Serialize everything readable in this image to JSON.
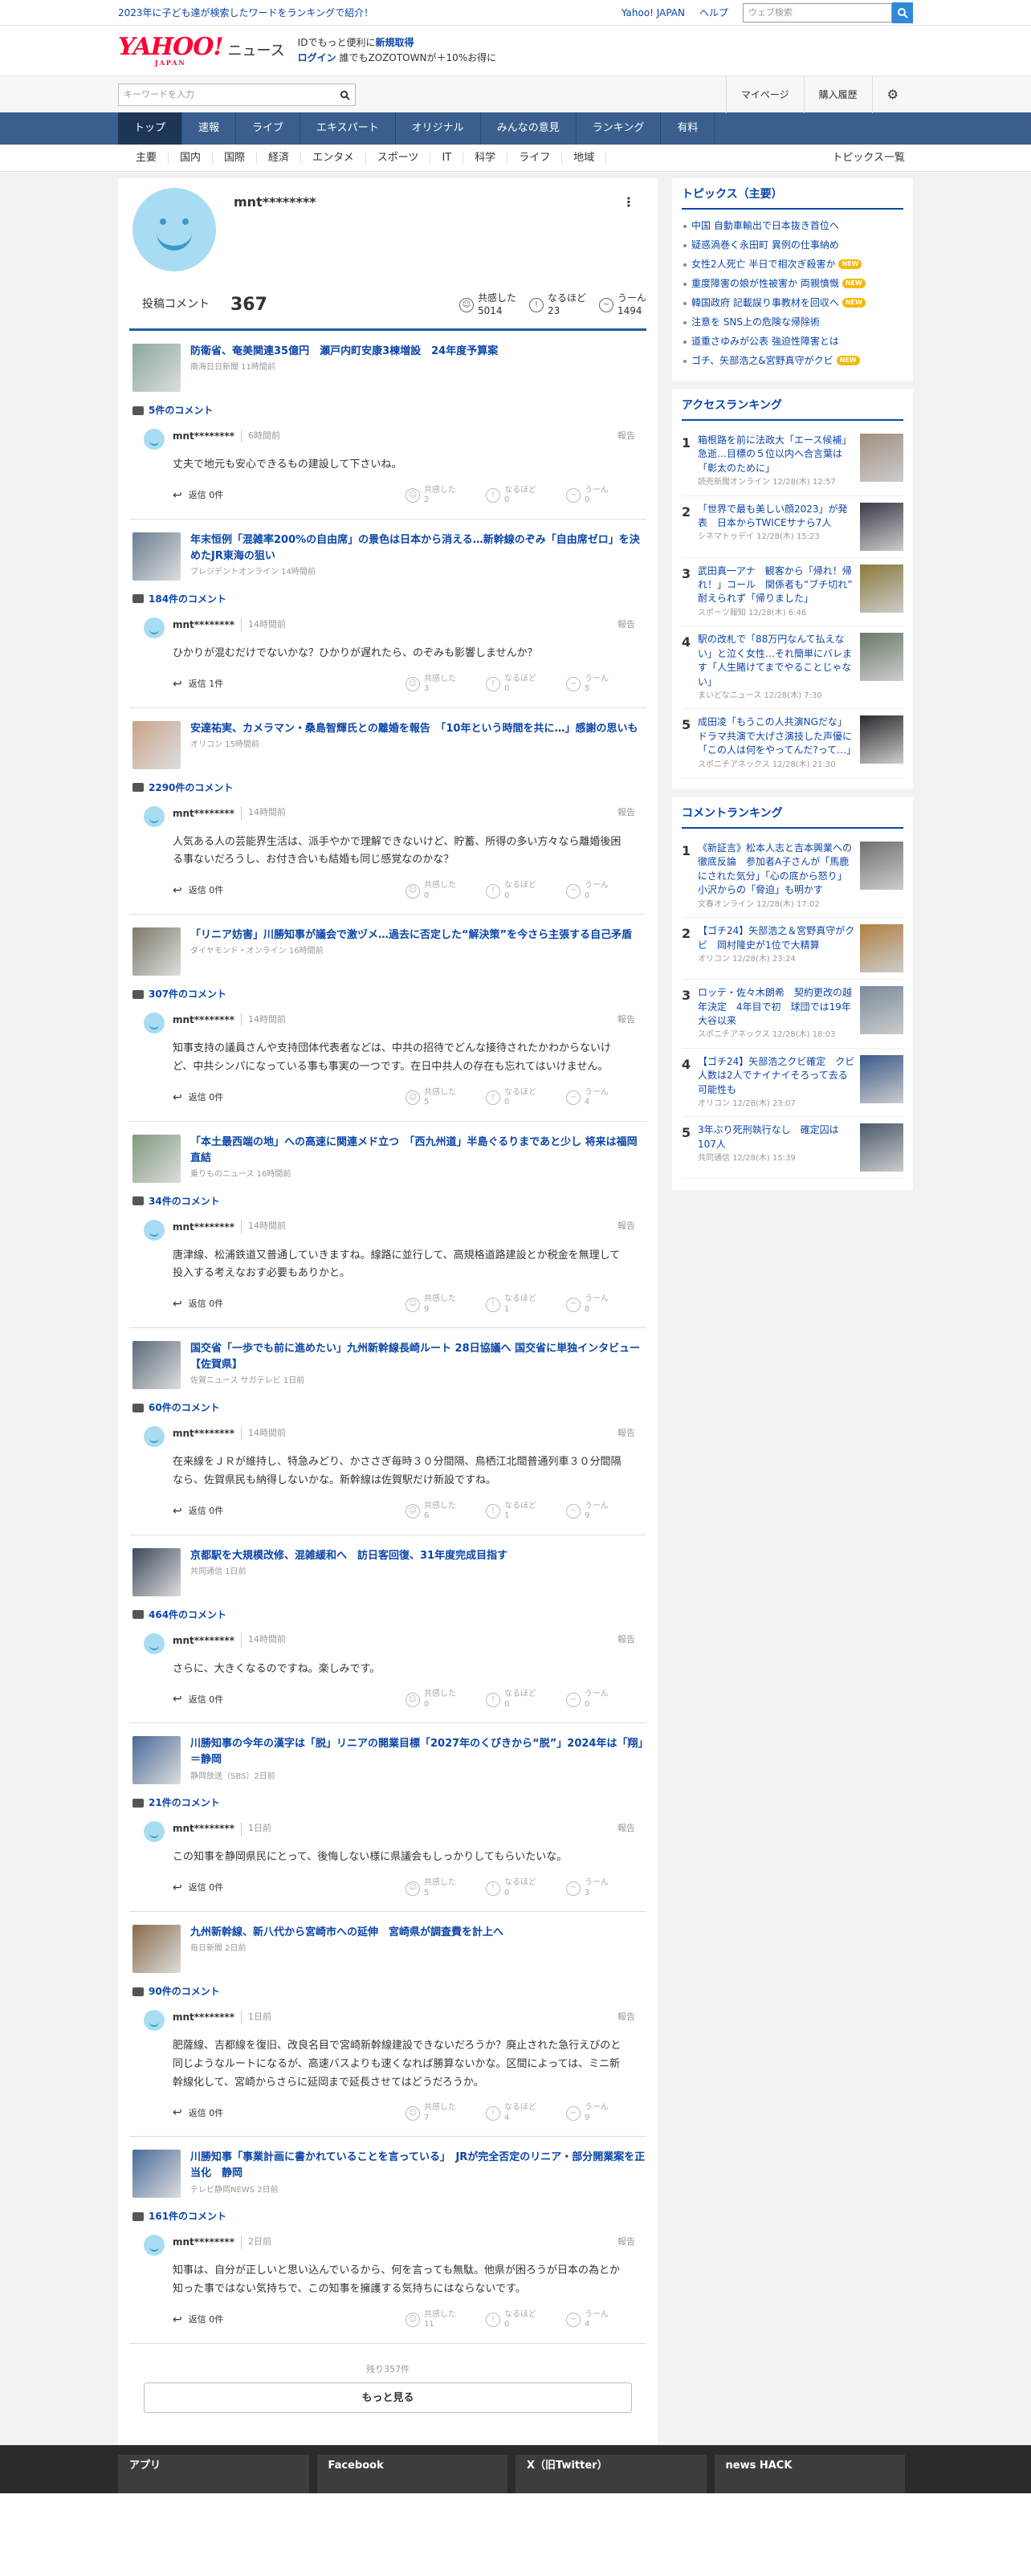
{
  "header": {
    "promo": "2023年に子ども達が検索したワードをランキングで紹介！",
    "yahoo_japan": "Yahoo! JAPAN",
    "help": "ヘルプ",
    "web_search_placeholder": "ウェブ検索",
    "logo_main": "YAHOO!",
    "logo_sub": "JAPAN",
    "news_word": "ニュース",
    "id_line_prefix": "IDでもっと便利に",
    "id_line_link": "新規取得",
    "login": "ログイン",
    "zozo": "誰でもZOZOTOWNが＋10%お得に",
    "keyword_placeholder": "キーワードを入力",
    "mypage": "マイページ",
    "purchase_history": "購入履歴"
  },
  "nav": [
    "トップ",
    "速報",
    "ライブ",
    "エキスパート",
    "オリジナル",
    "みんなの意見",
    "ランキング",
    "有料"
  ],
  "subnav": [
    "主要",
    "国内",
    "国際",
    "経済",
    "エンタメ",
    "スポーツ",
    "IT",
    "科学",
    "ライフ",
    "地域"
  ],
  "subnav_last": "トピックス一覧",
  "profile": {
    "name": "mnt********",
    "posts_label": "投稿コメント",
    "posts_count": "367",
    "agree_label": "共感した",
    "agree_count": "5014",
    "insight_label": "なるほど",
    "insight_count": "23",
    "hmm_label": "うーん",
    "hmm_count": "1494"
  },
  "labels": {
    "report": "報告",
    "reply_prefix": "返信",
    "agree": "共感した",
    "insight": "なるほど",
    "hmm": "うーん"
  },
  "cards": [
    {
      "headline": "防衛省、奄美関連35億円　瀬戸内町安康3棟増設　24年度予算案",
      "source": "南海日日新聞 11時間前",
      "count": "5件のコメント",
      "user": "mnt********",
      "time": "6時間前",
      "text": "丈夫で地元も安心できるもの建設して下さいね。",
      "reply": "返信 0件",
      "agree": "2",
      "insight": "0",
      "hmm": "0",
      "thumb": "#8aa89a"
    },
    {
      "headline": "年末恒例「混雑率200%の自由席」の景色は日本から消える…新幹線のぞみ「自由席ゼロ」を決めたJR東海の狙い",
      "source": "プレジデントオンライン 14時間前",
      "count": "184件のコメント",
      "user": "mnt********",
      "time": "14時間前",
      "text": "ひかりが混むだけでないかな？ひかりが遅れたら、のぞみも影響しませんか？",
      "reply": "返信 1件",
      "agree": "3",
      "insight": "0",
      "hmm": "5",
      "thumb": "#6a7f92"
    },
    {
      "headline": "安達祐実、カメラマン・桑島智輝氏との離婚を報告　「10年という時間を共に…」感謝の思いも",
      "source": "オリコン 15時間前",
      "count": "2290件のコメント",
      "user": "mnt********",
      "time": "14時間前",
      "text": "人気ある人の芸能界生活は、派手やかで理解できないけど、貯蓄、所得の多い方々なら離婚後困る事ないだろうし、お付き合いも結婚も同じ感覚なのかな？",
      "reply": "返信 0件",
      "agree": "0",
      "insight": "0",
      "hmm": "0",
      "thumb": "#c9a48a"
    },
    {
      "headline": "「リニア妨害」川勝知事が議会で激ヅメ…過去に否定した“解決策”を今さら主張する自己矛盾",
      "source": "ダイヤモンド・オンライン 16時間前",
      "count": "307件のコメント",
      "user": "mnt********",
      "time": "14時間前",
      "text": "知事支持の議員さんや支持団体代表者などは、中共の招待でどんな接待されたかわからないけど、中共シンパになっている事も事実の一つです。在日中共人の存在も忘れてはいけません。",
      "reply": "返信 0件",
      "agree": "5",
      "insight": "0",
      "hmm": "4",
      "thumb": "#7d7a6a"
    },
    {
      "headline": "「本土最西端の地」への高速に関連メド立つ　「西九州道」半島ぐるりまであと少し 将来は福岡直結",
      "source": "乗りものニュース 16時間前",
      "count": "34件のコメント",
      "user": "mnt********",
      "time": "14時間前",
      "text": "唐津線、松浦鉄道又普通していきますね。線路に並行して、高規格道路建設とか税金を無理して投入する考えなおす必要もありかと。",
      "reply": "返信 0件",
      "agree": "9",
      "insight": "1",
      "hmm": "8",
      "thumb": "#7f9a7c"
    },
    {
      "headline": "国交省「一歩でも前に進めたい」九州新幹線長崎ルート 28日協議へ 国交省に単独インタビュー【佐賀県】",
      "source": "佐賀ニュース サガテレビ 1日前",
      "count": "60件のコメント",
      "user": "mnt********",
      "time": "14時間前",
      "text": "在来線をＪＲが維持し、特急みどり、かささぎ毎時３０分間隔、鳥栖江北間普通列車３０分間隔なら、佐賀県民も納得しないかな。新幹線は佐賀駅だけ新設ですね。",
      "reply": "返信 0件",
      "agree": "6",
      "insight": "1",
      "hmm": "9",
      "thumb": "#5b6a7a"
    },
    {
      "headline": "京都駅を大規模改修、混雑緩和へ　訪日客回復、31年度完成目指す",
      "source": "共同通信 1日前",
      "count": "464件のコメント",
      "user": "mnt********",
      "time": "14時間前",
      "text": "さらに、大きくなるのですね。楽しみです。",
      "reply": "返信 0件",
      "agree": "0",
      "insight": "0",
      "hmm": "0",
      "thumb": "#3c4a5c"
    },
    {
      "headline": "川勝知事の今年の漢字は「脱」リニアの開業目標「2027年のくびきから“脱”」2024年は「翔」＝静岡",
      "source": "静岡放送（SBS）2日前",
      "count": "21件のコメント",
      "user": "mnt********",
      "time": "1日前",
      "text": "この知事を静岡県民にとって、後悔しない様に県議会もしっかりしてもらいたいな。",
      "reply": "返信 0件",
      "agree": "5",
      "insight": "0",
      "hmm": "3",
      "thumb": "#4a6a9a"
    },
    {
      "headline": "九州新幹線、新八代から宮崎市への延伸　宮崎県が調査費を計上へ",
      "source": "毎日新聞 2日前",
      "count": "90件のコメント",
      "user": "mnt********",
      "time": "1日前",
      "text": "肥薩線、吉都線を復旧、改良名目で宮崎新幹線建設できないだろうか？廃止された急行えびのと同じようなルートになるが、高速バスよりも速くなれば勝算ないかな。区間によっては、ミニ新幹線化して、宮崎からさらに延岡まで延長させてはどうだろうか。",
      "reply": "返信 0件",
      "agree": "7",
      "insight": "4",
      "hmm": "9",
      "thumb": "#8a6a4a"
    },
    {
      "headline": "川勝知事「事業計画に書かれていることを言っている」　JRが完全否定のリニア・部分開業案を正当化　静岡",
      "source": "テレビ静岡NEWS 2日前",
      "count": "161件のコメント",
      "user": "mnt********",
      "time": "2日前",
      "text": "知事は、自分が正しいと思い込んでいるから、何を言っても無駄。他県が困ろうが日本の為とか知った事ではない気持ちで、この知事を擁護する気持ちにはならないです。",
      "reply": "返信 0件",
      "agree": "11",
      "insight": "0",
      "hmm": "4",
      "thumb": "#4a6a9a"
    }
  ],
  "rest": "残り357件",
  "more": "もっと見る",
  "sidebar": {
    "topics_title": "トピックス（主要）",
    "topics": [
      {
        "text": "中国 自動車輸出で日本抜き首位へ",
        "new": false
      },
      {
        "text": "疑惑渦巻く永田町 異例の仕事納め",
        "new": false
      },
      {
        "text": "女性2人死亡 半日で相次ぎ殺害か",
        "new": true
      },
      {
        "text": "重度障害の娘が性被害か 両親憤慨",
        "new": true
      },
      {
        "text": "韓国政府 記載誤り事教材を回収へ",
        "new": true
      },
      {
        "text": "注意を SNS上の危険な帰除術",
        "new": false
      },
      {
        "text": "道重さゆみが公表 強迫性障害とは",
        "new": false
      },
      {
        "text": "ゴチ、矢部浩之&宮野真守がクビ",
        "new": true
      }
    ],
    "new_label": "NEW",
    "access_title": "アクセスランキング",
    "access": [
      {
        "n": "1",
        "text": "箱根路を前に法政大「エース候補」急逝…目標の５位以内へ合言葉は「彰太のために」",
        "src": "読売新聞オンライン 12/28(木) 12:57",
        "c": "#a09080"
      },
      {
        "n": "2",
        "text": "「世界で最も美しい顔2023」が発表　日本からTWICEサナら7人",
        "src": "シネマトゥデイ 12/28(木) 15:23",
        "c": "#3a3a48"
      },
      {
        "n": "3",
        "text": "武田真一アナ　観客から「帰れ！帰れ！」コール　関係者も“ブチ切れ”　耐えられず「帰りました」",
        "src": "スポーツ報知 12/28(木) 6:46",
        "c": "#8a7a3a"
      },
      {
        "n": "4",
        "text": "駅の改札で「88万円なんて払えない」と泣く女性…それ簡単にバレます「人生賭けてまでやることじゃない」",
        "src": "まいどなニュース 12/28(木) 7:30",
        "c": "#6a7a6a"
      },
      {
        "n": "5",
        "text": "成田凌「もうこの人共演NGだな」ドラマ共演で大げさ演技した声優に「この人は何をやってんだ?って…」",
        "src": "スポニチアネックス 12/28(木) 21:30",
        "c": "#2a2a30"
      }
    ],
    "comment_title": "コメントランキング",
    "comment": [
      {
        "n": "1",
        "text": "《新証言》松本人志と吉本興業への徹底反論　参加者A子さんが「馬鹿にされた気分」「心の底から怒り」小沢からの「脅迫」も明かす",
        "src": "文春オンライン 12/28(木) 17:02",
        "c": "#707070"
      },
      {
        "n": "2",
        "text": "【ゴチ24】矢部浩之＆宮野真守がクビ　岡村隆史が1位で大精算",
        "src": "オリコン 12/28(木) 23:24",
        "c": "#b08040"
      },
      {
        "n": "3",
        "text": "ロッテ・佐々木朗希　契約更改の越年決定　4年目で初　球団では19年大谷以来",
        "src": "スポニチアネックス 12/28(木) 18:03",
        "c": "#7a8a9a"
      },
      {
        "n": "4",
        "text": "【ゴチ24】矢部浩之クビ確定　クビ人数は2人でナイナイそろって去る可能性も",
        "src": "オリコン 12/28(木) 23:07",
        "c": "#3a5a8a"
      },
      {
        "n": "5",
        "text": "3年ぶり死刑執行なし　確定囚は107人",
        "src": "共同通信 12/28(木) 15:39",
        "c": "#4a5a6a"
      }
    ]
  },
  "footer": [
    "アプリ",
    "Facebook",
    "X（旧Twitter）",
    "news HACK"
  ],
  "colors": {
    "nav": "#3a5f8f",
    "link": "#0b46a8",
    "accent": "#1a5fa8"
  }
}
